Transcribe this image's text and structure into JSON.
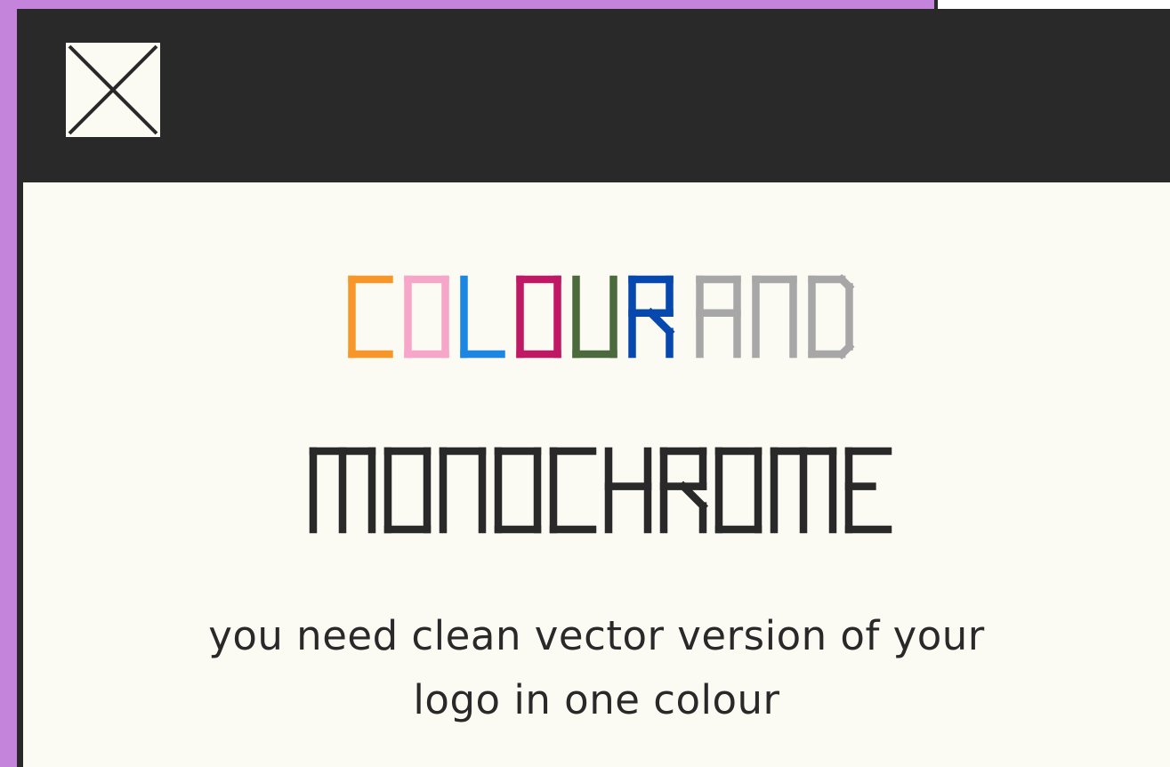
{
  "window": {
    "close_icon": "close-x-icon"
  },
  "headline": {
    "line1_word1_letters": [
      {
        "char": "C",
        "color": "#f7972a"
      },
      {
        "char": "O",
        "color": "#f6a6c8"
      },
      {
        "char": "L",
        "color": "#1b87e3"
      },
      {
        "char": "O",
        "color": "#bf1864"
      },
      {
        "char": "U",
        "color": "#4b6b3d"
      },
      {
        "char": "R",
        "color": "#0648ad"
      }
    ],
    "line1_word2": "AND",
    "line1_word2_color": "#a7a7a7",
    "line2": "MONOCHROME",
    "line2_color": "#292929"
  },
  "subtitle": {
    "line1": "you need clean vector version of your",
    "line2": "logo in one colour"
  },
  "colors": {
    "background": "#c484dc",
    "window_frame": "#292929",
    "content_bg": "#fbfaf3"
  }
}
